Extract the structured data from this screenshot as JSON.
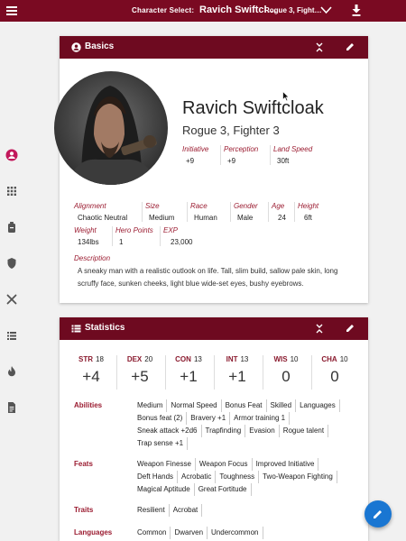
{
  "topbar": {
    "character_select_label": "Character Select:",
    "character_name": "Ravich Swiftcl…",
    "character_class": "Rogue 3, Fight…"
  },
  "sidebar": {
    "items": [
      "person-icon",
      "apps-grid-icon",
      "backpack-icon",
      "shield-icon",
      "crossed-swords-icon",
      "list-icon",
      "fire-icon",
      "document-icon"
    ]
  },
  "basics": {
    "title": "Basics",
    "name": "Ravich Swiftcloak",
    "class_line": "Rogue 3, Fighter 3",
    "stats": [
      {
        "label": "Initiative",
        "value": "+9"
      },
      {
        "label": "Perception",
        "value": "+9"
      },
      {
        "label": "Land Speed",
        "value": "30ft"
      }
    ],
    "fields": [
      {
        "label": "Alignment",
        "value": "Chaotic Neutral"
      },
      {
        "label": "Size",
        "value": "Medium"
      },
      {
        "label": "Race",
        "value": "Human"
      },
      {
        "label": "Gender",
        "value": "Male"
      },
      {
        "label": "Age",
        "value": "24"
      },
      {
        "label": "Height",
        "value": "6ft"
      },
      {
        "label": "Weight",
        "value": "134lbs"
      },
      {
        "label": "Hero Points",
        "value": "1"
      },
      {
        "label": "EXP",
        "value": "23,000"
      }
    ],
    "description_label": "Description",
    "description": "A sneaky man with a realistic outlook on life. Tall, slim build, sallow pale skin, long scruffy face, sunken cheeks, light blue wide-set eyes, bushy eyebrows."
  },
  "statistics": {
    "title": "Statistics",
    "abilities": [
      {
        "name": "STR",
        "score": "18",
        "mod": "+4"
      },
      {
        "name": "DEX",
        "score": "20",
        "mod": "+5"
      },
      {
        "name": "CON",
        "score": "13",
        "mod": "+1"
      },
      {
        "name": "INT",
        "score": "13",
        "mod": "+1"
      },
      {
        "name": "WIS",
        "score": "10",
        "mod": "0"
      },
      {
        "name": "CHA",
        "score": "10",
        "mod": "0"
      }
    ],
    "rows": [
      {
        "label": "Abilities",
        "items": [
          "Medium",
          "Normal Speed",
          "Bonus Feat",
          "Skilled",
          "Languages",
          "Bonus feat (2)",
          "Bravery +1",
          "Armor training 1",
          "Sneak attack +2d6",
          "Trapfinding",
          "Evasion",
          "Rogue talent",
          "Trap sense +1"
        ]
      },
      {
        "label": "Feats",
        "items": [
          "Weapon Finesse",
          "Weapon Focus",
          "Improved Initiative",
          "Deft Hands",
          "Acrobatic",
          "Toughness",
          "Two-Weapon Fighting",
          "Magical Aptitude",
          "Great Fortitude"
        ]
      },
      {
        "label": "Traits",
        "items": [
          "Resilient",
          "Acrobat"
        ]
      },
      {
        "label": "Languages",
        "items": [
          "Common",
          "Dwarven",
          "Undercommon"
        ]
      }
    ]
  },
  "colors": {
    "brand": "#7a0a22",
    "accent_label": "#9b1c31",
    "fab": "#1976d2"
  }
}
